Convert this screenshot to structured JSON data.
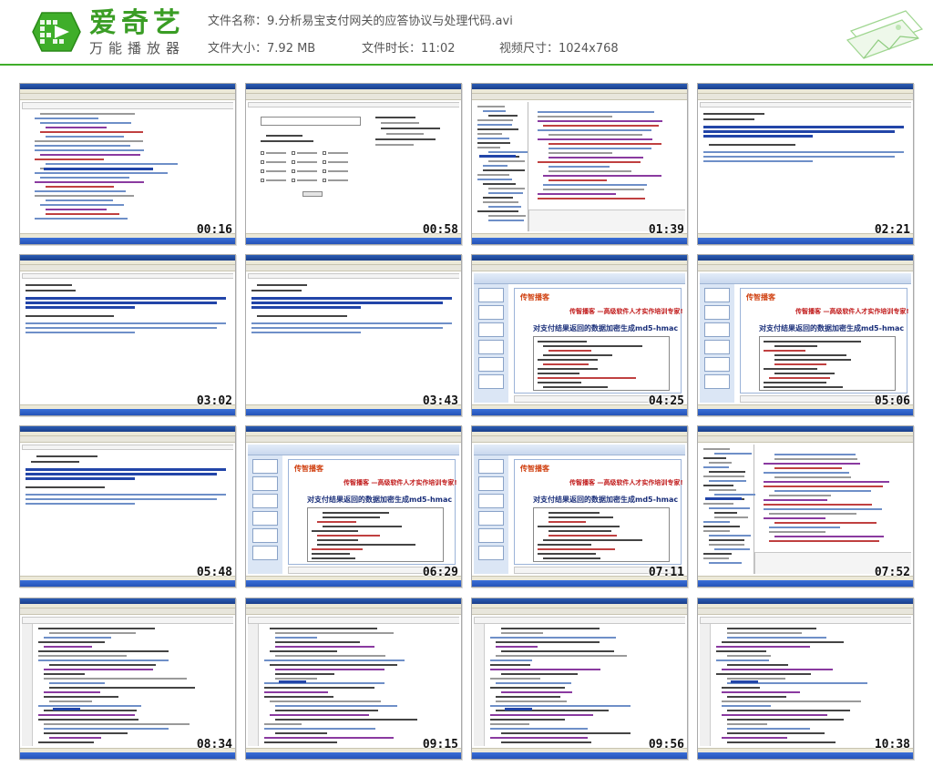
{
  "app": {
    "brand_name": "爱奇艺",
    "brand_subtitle": "万能播放器",
    "accent_color": "#3fae2a"
  },
  "file_info": {
    "name_label": "文件名称：",
    "name_value": "9.分析易宝支付网关的应答协议与处理代码.avi",
    "size_label": "文件大小：",
    "size_value": "7.92 MB",
    "duration_label": "文件时长：",
    "duration_value": "11:02",
    "dimension_label": "视频尺寸：",
    "dimension_value": "1024x768"
  },
  "thumbnails": [
    {
      "time": "00:16",
      "kind": "eclipse-xml"
    },
    {
      "time": "00:58",
      "kind": "ie-form"
    },
    {
      "time": "01:39",
      "kind": "eclipse-tree"
    },
    {
      "time": "02:21",
      "kind": "ie-text"
    },
    {
      "time": "03:02",
      "kind": "ie-text"
    },
    {
      "time": "03:43",
      "kind": "ie-text"
    },
    {
      "time": "04:25",
      "kind": "ppt"
    },
    {
      "time": "05:06",
      "kind": "ppt"
    },
    {
      "time": "05:48",
      "kind": "ie-text"
    },
    {
      "time": "06:29",
      "kind": "ppt"
    },
    {
      "time": "07:11",
      "kind": "ppt"
    },
    {
      "time": "07:52",
      "kind": "eclipse-tree"
    },
    {
      "time": "08:34",
      "kind": "eclipse-code"
    },
    {
      "time": "09:15",
      "kind": "eclipse-code"
    },
    {
      "time": "09:56",
      "kind": "eclipse-code"
    },
    {
      "time": "10:38",
      "kind": "eclipse-code"
    }
  ],
  "ppt": {
    "banner_title": "传智播客 —高级软件人才实作培训专家!",
    "slide_heading": "对支付结果返回的数据加密生成md5-hmac"
  }
}
